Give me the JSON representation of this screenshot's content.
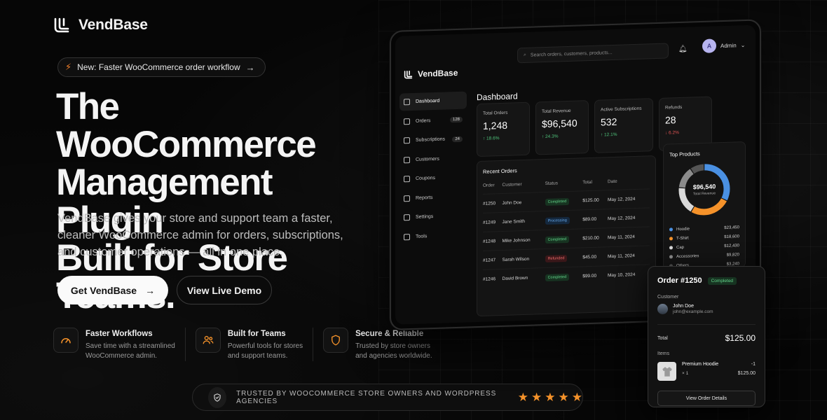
{
  "brand": {
    "name": "VendBase"
  },
  "announcement": {
    "text": "New: Faster WooCommerce order workflow",
    "arrow": "→"
  },
  "hero": {
    "title_line1": "The WooCommerce",
    "title_line2": "Management Plugin",
    "title_line3": "Built for Store Teams.",
    "subtitle": "VendBase gives your store and support team a faster, cleaner WooCommerce admin for orders, subscriptions, and customer operations — all in one place.",
    "primary_cta": "Get VendBase",
    "primary_arrow": "→",
    "secondary_cta": "View Live Demo"
  },
  "features": [
    {
      "icon": "speedometer-icon",
      "title": "Faster Workflows",
      "desc_1": "Save time with a streamlined",
      "desc_2": "WooCommerce admin."
    },
    {
      "icon": "team-icon",
      "title": "Built for Teams",
      "desc_1": "Powerful tools for stores",
      "desc_2": "and support teams."
    },
    {
      "icon": "shield-icon",
      "title": "Secure & Reliable",
      "desc_1": "Trusted by store owners",
      "desc_2": "and agencies worldwide."
    }
  ],
  "trust": {
    "text": "TRUSTED BY WOOCOMMERCE STORE OWNERS AND WORDPRESS AGENCIES",
    "rating": 5
  },
  "dashboard": {
    "brand": "VendBase",
    "search_placeholder": "Search orders, customers, products...",
    "user": {
      "initial": "A",
      "name": "Admin"
    },
    "title": "Dashboard",
    "nav": [
      {
        "label": "Dashboard",
        "count": ""
      },
      {
        "label": "Orders",
        "count": "128"
      },
      {
        "label": "Subscriptions",
        "count": "24"
      },
      {
        "label": "Customers",
        "count": ""
      },
      {
        "label": "Coupons",
        "count": ""
      },
      {
        "label": "Reports",
        "count": ""
      },
      {
        "label": "Settings",
        "count": ""
      },
      {
        "label": "Tools",
        "count": ""
      }
    ],
    "stats": [
      {
        "label": "Total Orders",
        "value": "1,248",
        "delta": "↑ 18.6%"
      },
      {
        "label": "Total Revenue",
        "value": "$96,540",
        "delta": "↑ 24.3%"
      },
      {
        "label": "Active Subscriptions",
        "value": "532",
        "delta": "↑ 12.1%"
      },
      {
        "label": "Refunds",
        "value": "28",
        "delta": "↓ 6.2%"
      }
    ],
    "recent_orders": {
      "title": "Recent Orders",
      "headers": [
        "Order",
        "Customer",
        "Status",
        "Total",
        "Date"
      ],
      "rows": [
        {
          "order": "#1250",
          "customer": "John Doe",
          "status": "Completed",
          "total": "$125.00",
          "date": "May 12, 2024"
        },
        {
          "order": "#1249",
          "customer": "Jane Smith",
          "status": "Processing",
          "total": "$89.00",
          "date": "May 12, 2024"
        },
        {
          "order": "#1248",
          "customer": "Mike Johnson",
          "status": "Completed",
          "total": "$210.00",
          "date": "May 11, 2024"
        },
        {
          "order": "#1247",
          "customer": "Sarah Wilson",
          "status": "Refunded",
          "total": "$45.00",
          "date": "May 11, 2024"
        },
        {
          "order": "#1246",
          "customer": "David Brown",
          "status": "Completed",
          "total": "$99.00",
          "date": "May 10, 2024"
        }
      ]
    },
    "top_products": {
      "title": "Top Products",
      "center_value": "$96,540",
      "center_label": "Total Revenue",
      "items": [
        {
          "name": "Hoodie",
          "value": "$23,450",
          "color": "#4a90e2",
          "share": 0.33
        },
        {
          "name": "T-Shirt",
          "value": "$18,600",
          "color": "#f5922a",
          "share": 0.26
        },
        {
          "name": "Cap",
          "value": "$12,430",
          "color": "#d9d9d9",
          "share": 0.18
        },
        {
          "name": "Accessories",
          "value": "$9,820",
          "color": "#8c8c8c",
          "share": 0.14
        },
        {
          "name": "Others",
          "value": "$3,240",
          "color": "#555555",
          "share": 0.09
        }
      ]
    }
  },
  "order_popup": {
    "title": "Order #1250",
    "status": "Completed",
    "customer_label": "Customer",
    "customer_name": "John Doe",
    "customer_email": "john@example.com",
    "total_label": "Total",
    "total_value": "$125.00",
    "items_label": "Items",
    "item_name": "Premium Hoodie",
    "item_qty": "× 1",
    "item_count": "-1",
    "item_price": "$125.00",
    "button": "View Order Details"
  }
}
